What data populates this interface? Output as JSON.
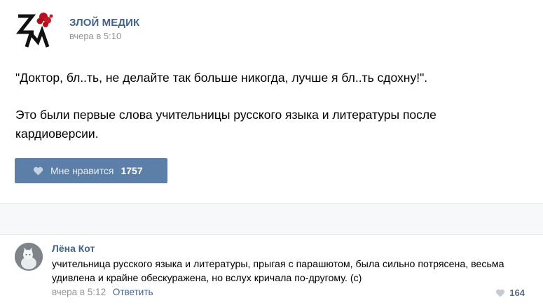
{
  "post": {
    "author": "ЗЛОЙ МЕДИК",
    "time": "вчера в 5:10",
    "paragraphs": [
      "\"Доктор, бл..ть, не делайте так больше никогда, лучше я бл..ть сдохну!\".",
      "Это были первые слова учительницы русского языка и литературы после кардиоверсии."
    ],
    "like_label": "Мне нравится",
    "like_count": "1757",
    "avatar_icon": "logo-zm-icon"
  },
  "comment": {
    "author": "Лёна Кот",
    "text": "учительница русского языка и литературы, прыгая с парашютом, была сильно потрясена, весьма удивлена и крайне обескуражена, но вслух кричала по-другому. (с)",
    "time": "вчера в 5:12",
    "reply_label": "Ответить",
    "like_count": "164",
    "avatar_icon": "cat-avatar-icon"
  },
  "colors": {
    "link": "#42648b",
    "like_button": "#5b7fa6",
    "muted": "#939393"
  }
}
